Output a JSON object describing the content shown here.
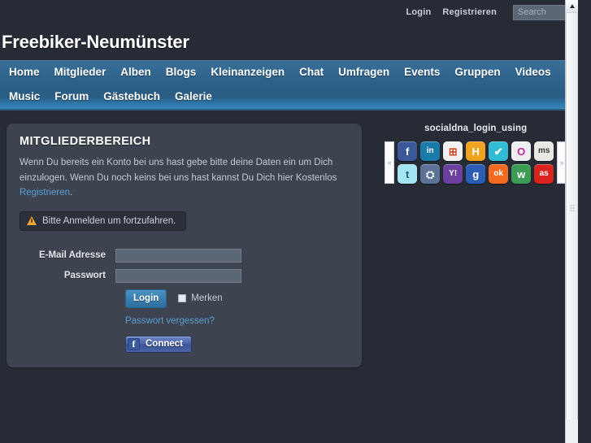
{
  "topbar": {
    "login": "Login",
    "register": "Registrieren",
    "search_placeholder": "Search",
    "search_value": ""
  },
  "site": {
    "title": "Freebiker-Neumünster"
  },
  "nav": {
    "items": [
      "Home",
      "Mitglieder",
      "Alben",
      "Blogs",
      "Kleinanzeigen",
      "Chat",
      "Umfragen",
      "Events",
      "Gruppen",
      "Videos",
      "Music",
      "Forum",
      "Gästebuch",
      "Galerie"
    ]
  },
  "login_panel": {
    "title": "MITGLIEDERBEREICH",
    "description_before": "Wenn Du bereits ein Konto bei uns hast gebe bitte deine Daten ein um Dich einzulogen. Wenn Du noch keins bei uns hast kannst Du Dich hier Kostenlos ",
    "description_link": "Registrieren",
    "description_after": ".",
    "alert_text": "Bitte Anmelden um fortzufahren.",
    "email_label": "E-Mail Adresse",
    "email_value": "",
    "password_label": "Passwort",
    "password_value": "",
    "login_button": "Login",
    "remember_label": "Merken",
    "remember_checked": false,
    "forgot_password": "Passwort vergessen?",
    "facebook_icon_letter": "f",
    "facebook_connect": "Connect"
  },
  "social": {
    "title": "socialdna_login_using",
    "prev_arrow": "«",
    "next_arrow": "»",
    "rows": [
      [
        {
          "name": "facebook-icon",
          "label": "f",
          "bg": "#3b5998",
          "fg": "#ffffff"
        },
        {
          "name": "linkedin-icon",
          "label": "in",
          "bg": "#1a7aa8",
          "fg": "#ffffff"
        },
        {
          "name": "windows-live-icon",
          "label": "⊞",
          "bg": "#f2f2f0",
          "fg": "#d24726"
        },
        {
          "name": "hyves-icon",
          "label": "H",
          "bg": "#f0a31e",
          "fg": "#ffffff"
        },
        {
          "name": "foursquare-icon",
          "label": "✔",
          "bg": "#31bbd4",
          "fg": "#ffffff"
        },
        {
          "name": "orkut-icon",
          "label": "O",
          "bg": "#efeef2",
          "fg": "#c0279a"
        },
        {
          "name": "myspace-icon",
          "label": "ms",
          "bg": "#ebe9e4",
          "fg": "#33373c"
        }
      ],
      [
        {
          "name": "twitter-icon",
          "label": "t",
          "bg": "#a5e4f2",
          "fg": "#17608c"
        },
        {
          "name": "myspace-group-icon",
          "label": "⛭",
          "bg": "#5b7397",
          "fg": "#ffffff"
        },
        {
          "name": "yahoo-icon",
          "label": "Y!",
          "bg": "#6b3f9e",
          "fg": "#ffffff"
        },
        {
          "name": "google-icon",
          "label": "g",
          "bg": "#2b5db4",
          "fg": "#ffffff"
        },
        {
          "name": "odnoklassniki-icon",
          "label": "ok",
          "bg": "#f36a21",
          "fg": "#ffffff"
        },
        {
          "name": "vkontakte-icon",
          "label": "w",
          "bg": "#3d9c54",
          "fg": "#ffffff"
        },
        {
          "name": "lastfm-icon",
          "label": "as",
          "bg": "#d8231f",
          "fg": "#ffffff"
        }
      ]
    ]
  },
  "theme": {
    "body_bg": "#262b35",
    "panel_bg": "#3d4450",
    "nav_blue": "#2d6189",
    "link_blue": "#5a9fd4",
    "accent_button": "#3a7fb0"
  }
}
